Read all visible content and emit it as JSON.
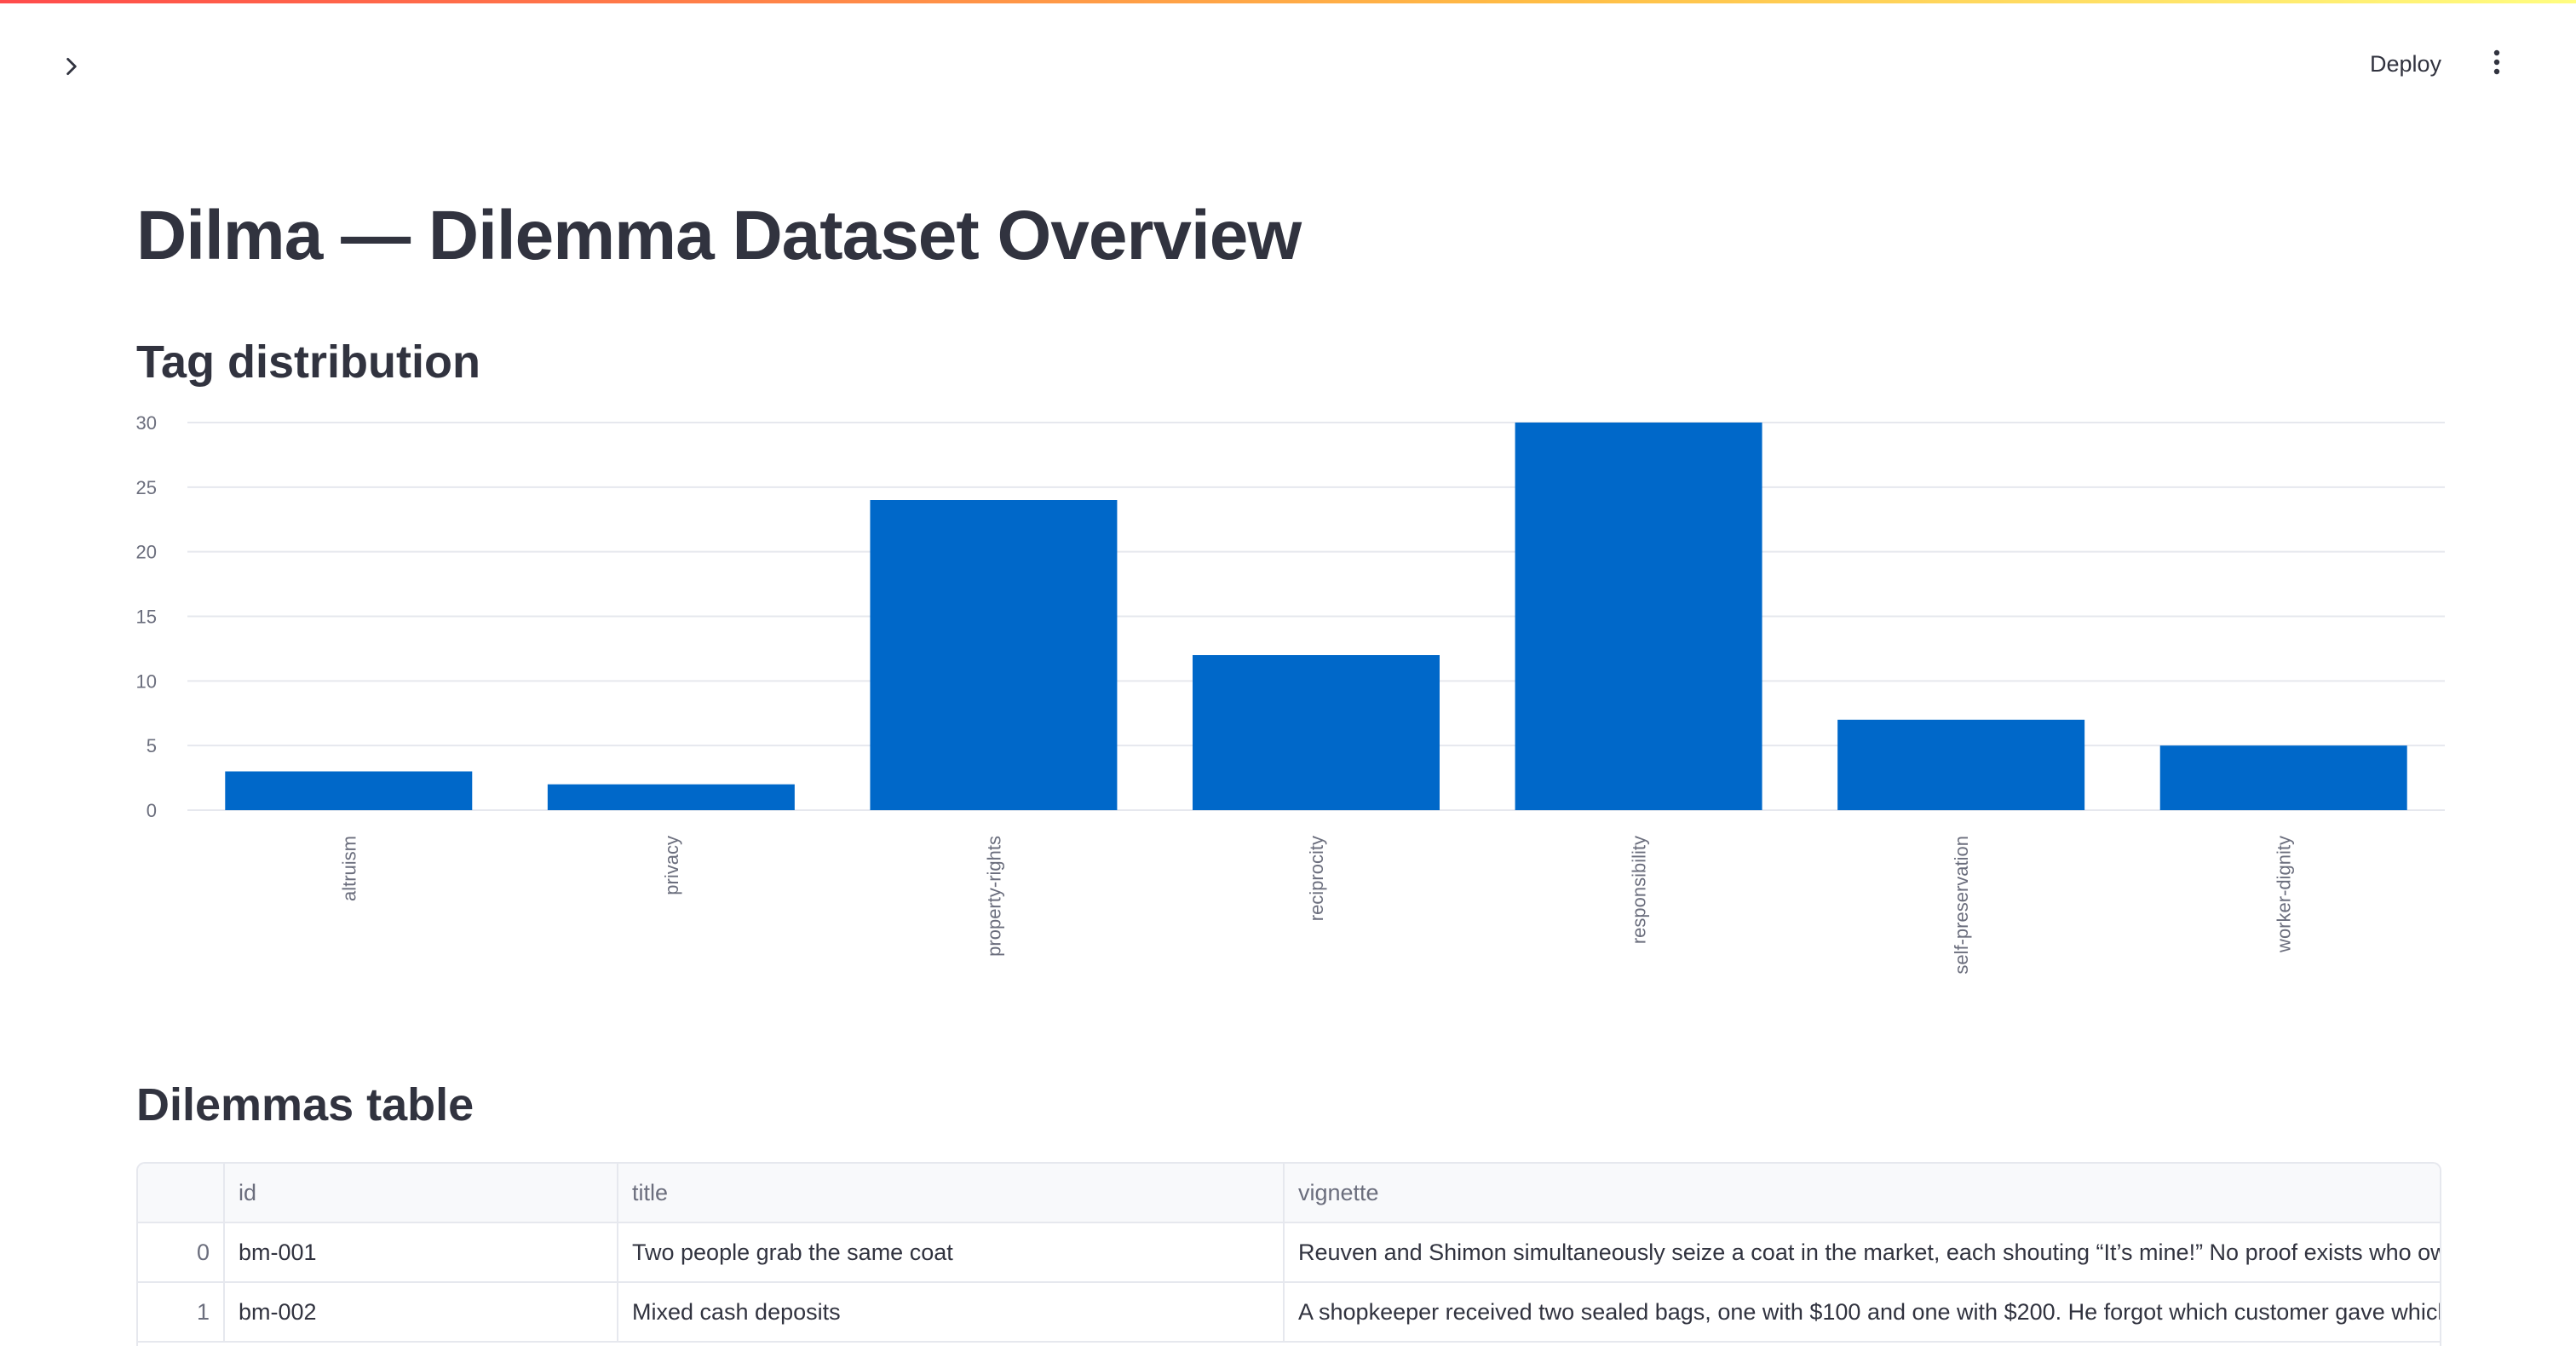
{
  "header": {
    "deploy_label": "Deploy",
    "sidebar_toggle_icon": "chevron-right-icon",
    "menu_icon": "more-vertical-icon"
  },
  "page": {
    "title": "Dilma — Dilemma Dataset Overview"
  },
  "sections": {
    "chart_title": "Tag distribution",
    "table_title": "Dilemmas table"
  },
  "colors": {
    "accent_gradient_start": "#ff4b4b",
    "accent_gradient_end": "#fffd80",
    "bar": "#0068c9"
  },
  "chart_data": {
    "type": "bar",
    "categories": [
      "altruism",
      "privacy",
      "property-rights",
      "reciprocity",
      "responsibility",
      "self-preservation",
      "worker-dignity"
    ],
    "values": [
      3,
      2,
      24,
      12,
      30,
      7,
      5
    ],
    "title": "",
    "xlabel": "",
    "ylabel": "",
    "ylim": [
      0,
      30
    ],
    "yticks": [
      0,
      5,
      10,
      15,
      20,
      25,
      30
    ],
    "grid": true,
    "legend": "none"
  },
  "table": {
    "columns": [
      "",
      "id",
      "title",
      "vignette"
    ],
    "rows": [
      {
        "index": "0",
        "id": "bm-001",
        "title": "Two people grab the same coat",
        "vignette": "Reuven and Shimon simultaneously seize a coat in the market, each shouting “It’s mine!” No proof exists who owns it."
      },
      {
        "index": "1",
        "id": "bm-002",
        "title": "Mixed cash deposits",
        "vignette": "A shopkeeper received two sealed bags, one with $100 and one with $200. He forgot which customer gave which."
      }
    ]
  }
}
